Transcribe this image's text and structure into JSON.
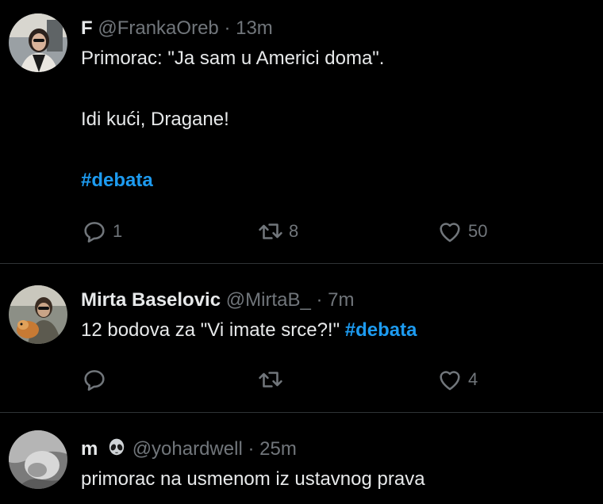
{
  "colors": {
    "background": "#000000",
    "text_primary": "#e7e9ea",
    "text_secondary": "#71767b",
    "hashtag": "#1d9bf0",
    "divider": "#2f3336"
  },
  "tweets": [
    {
      "display_name": "F",
      "handle": "@FrankaOreb",
      "separator": "·",
      "time": "13m",
      "body": {
        "line1": "Primorac: \"Ja sam u Americi doma\".",
        "line2": "Idi kući, Dragane!",
        "hashtag": "#debata"
      },
      "actions": {
        "reply_icon": "reply-icon",
        "reply_count": "1",
        "retweet_icon": "retweet-icon",
        "retweet_count": "8",
        "like_icon": "heart-icon",
        "like_count": "50"
      }
    },
    {
      "display_name": "Mirta Baselovic",
      "handle": "@MirtaB_",
      "separator": "·",
      "time": "7m",
      "body": {
        "text": "12 bodova za \"Vi imate srce?!\"",
        "hashtag": "#debata"
      },
      "actions": {
        "reply_icon": "reply-icon",
        "reply_count": "",
        "retweet_icon": "retweet-icon",
        "retweet_count": "",
        "like_icon": "heart-icon",
        "like_count": "4"
      }
    },
    {
      "display_name": "m",
      "name_emoji": "alien-icon",
      "handle": "@yohardwell",
      "separator": "·",
      "time": "25m",
      "body": {
        "text": "primorac na usmenom iz ustavnog prava"
      }
    }
  ]
}
